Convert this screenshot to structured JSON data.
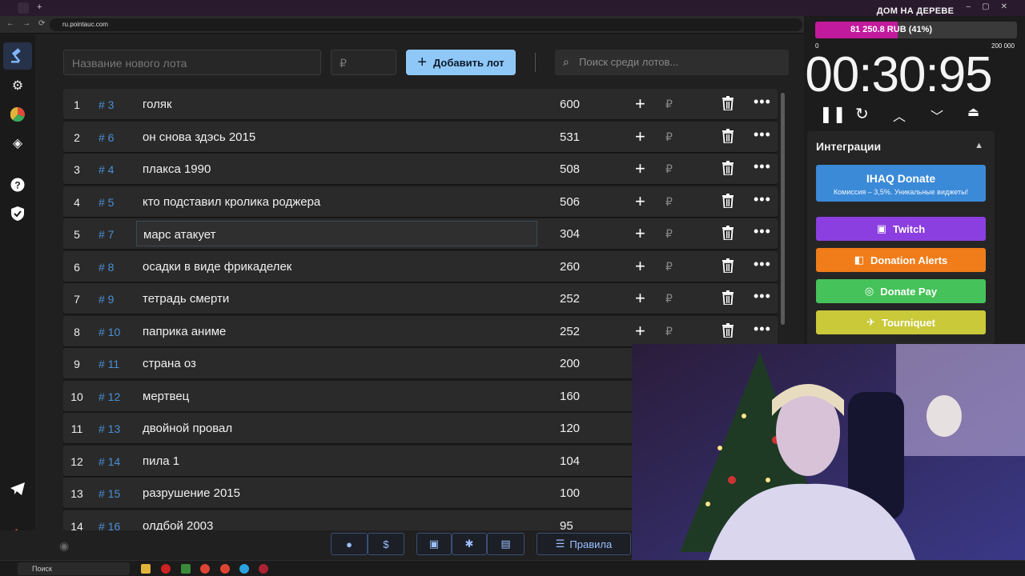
{
  "browser": {
    "url": "ru.pointauc.com",
    "new_tab_symbol": "+"
  },
  "toolbar": {
    "new_lot_placeholder": "Название нового лота",
    "price_placeholder": "₽",
    "add_button_label": "Добавить лот",
    "search_placeholder": "Поиск среди лотов..."
  },
  "lots": [
    {
      "pos": "1",
      "id": "# 3",
      "name": "голяк",
      "amount": "600"
    },
    {
      "pos": "2",
      "id": "# 6",
      "name": "он снова здэсь 2015",
      "amount": "531"
    },
    {
      "pos": "3",
      "id": "# 4",
      "name": "плакса 1990",
      "amount": "508"
    },
    {
      "pos": "4",
      "id": "# 5",
      "name": "кто подставил кролика роджера",
      "amount": "506"
    },
    {
      "pos": "5",
      "id": "# 7",
      "name": "марс атакует",
      "amount": "304"
    },
    {
      "pos": "6",
      "id": "# 8",
      "name": "осадки в виде фрикаделек",
      "amount": "260"
    },
    {
      "pos": "7",
      "id": "# 9",
      "name": "тетрадь смерти",
      "amount": "252"
    },
    {
      "pos": "8",
      "id": "# 10",
      "name": "паприка аниме",
      "amount": "252"
    },
    {
      "pos": "9",
      "id": "# 11",
      "name": "страна оз",
      "amount": "200"
    },
    {
      "pos": "10",
      "id": "# 12",
      "name": "мертвец",
      "amount": "160"
    },
    {
      "pos": "11",
      "id": "# 13",
      "name": " двойной провал",
      "amount": "120"
    },
    {
      "pos": "12",
      "id": "# 14",
      "name": "пила 1",
      "amount": "104"
    },
    {
      "pos": "13",
      "id": "# 15",
      "name": "разрушение 2015",
      "amount": "100"
    },
    {
      "pos": "14",
      "id": "# 16",
      "name": "олдбой 2003",
      "amount": "95"
    }
  ],
  "row_symbols": {
    "plus": "+",
    "currency": "₽",
    "more": "•••"
  },
  "goal": {
    "title": "ДОМ НА ДЕРЕВЕ",
    "progress_text": "81 250.8 RUB (41%)",
    "progress_fraction": 0.41,
    "min_label": "0",
    "max_label": "200 000"
  },
  "timer": {
    "display": "00:30:95"
  },
  "integrations": {
    "header": "Интеграции",
    "donate_title": "IHAQ Donate",
    "donate_subtitle": "Комиссия – 3,5%. Уникальные виджеты!",
    "buttons": [
      {
        "label": "Twitch",
        "color": "#8c3fe0"
      },
      {
        "label": "Donation Alerts",
        "color": "#f07d1a"
      },
      {
        "label": "Donate Pay",
        "color": "#46c25a"
      },
      {
        "label": "Tourniquet",
        "color": "#c9c93a"
      }
    ]
  },
  "bottom": {
    "rules_label": "Правила"
  },
  "taskbar": {
    "search_label": "Поиск"
  },
  "colors": {
    "accent": "#8fc8f7",
    "id_blue": "#4a8fd6",
    "goal_fill": "#c21a9c"
  }
}
